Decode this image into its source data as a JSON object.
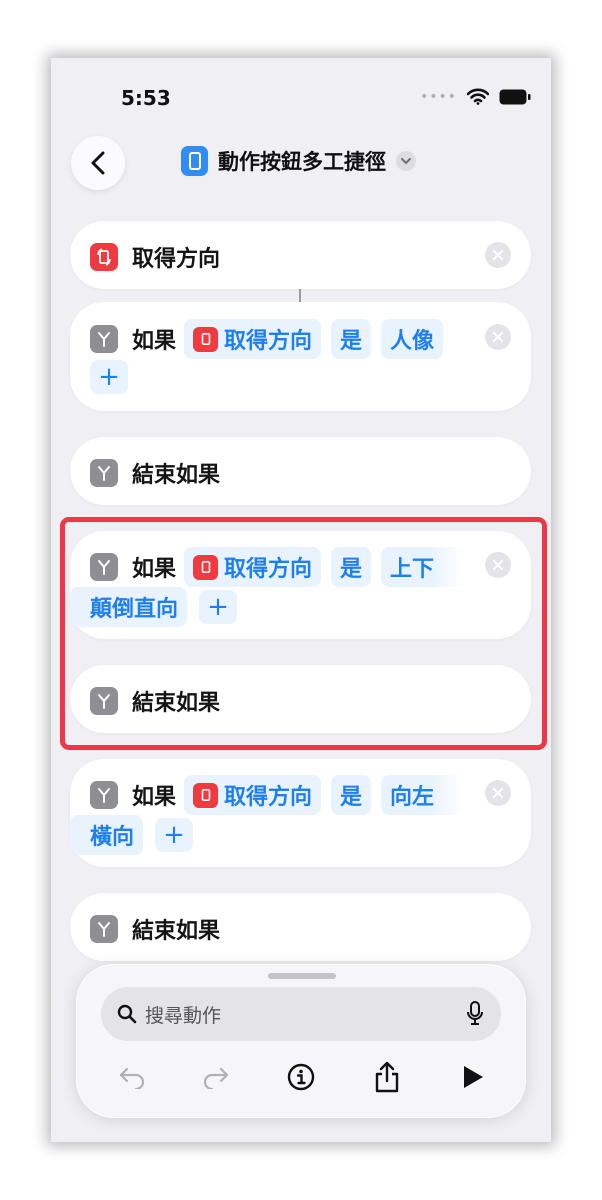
{
  "status": {
    "time": "5:53"
  },
  "nav": {
    "title": "動作按鈕多工捷徑"
  },
  "actions": [
    {
      "label": "取得方向"
    },
    {
      "label": "如果",
      "var": "取得方向",
      "op": "是",
      "value": "人像"
    },
    {
      "label": "結束如果"
    },
    {
      "label": "如果",
      "var": "取得方向",
      "op": "是",
      "value_line1": "上下",
      "value_line2": "顛倒直向"
    },
    {
      "label": "結束如果"
    },
    {
      "label": "如果",
      "var": "取得方向",
      "op": "是",
      "value_line1": "向左",
      "value_line2": "橫向"
    },
    {
      "label": "結束如果"
    }
  ],
  "plus_symbol": "+",
  "search": {
    "placeholder": "搜尋動作"
  },
  "icons": [
    "back-chevron-icon",
    "shortcut-app-icon",
    "chevron-down-icon",
    "orientation-icon",
    "if-branch-icon",
    "remove-icon",
    "search-icon",
    "mic-icon",
    "undo-icon",
    "redo-icon",
    "info-icon",
    "share-icon",
    "play-icon"
  ],
  "colors": {
    "accent": "#1E7FF0",
    "red_icon": "#EF3A3F",
    "highlight": "#F2364A",
    "gray_icon": "#8E8E93"
  }
}
